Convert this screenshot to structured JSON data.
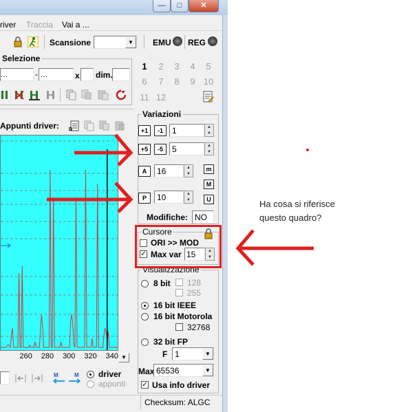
{
  "window": {
    "controls": {
      "minimize": "—",
      "maximize": "□",
      "close": "✕"
    }
  },
  "menu": {
    "items": [
      {
        "label": "river",
        "disabled": false
      },
      {
        "label": "Traccia",
        "disabled": true
      },
      {
        "label": "Vai a ...",
        "disabled": false
      }
    ]
  },
  "toolbar": {
    "scansione_label": "Scansione",
    "scansione_value": "",
    "emu_label": "EMU",
    "reg_label": "REG"
  },
  "selezione": {
    "title": "Selezione",
    "field1": "...",
    "field2": "...",
    "x_label": "x",
    "x_value": "",
    "dim_label": "dim.",
    "dim_value": ""
  },
  "numbers": {
    "row1": [
      "1",
      "2",
      "3",
      "4",
      "5"
    ],
    "row2": [
      "6",
      "7",
      "8",
      "9",
      "10"
    ],
    "row3": [
      "11",
      "12"
    ]
  },
  "appunti": {
    "label": "Appunti driver:"
  },
  "variazioni": {
    "title": "Variazioni",
    "v1": "1",
    "v2": "5",
    "v3": "16",
    "v4": "10",
    "modifiche_label": "Modifiche:",
    "modifiche_value": "NO",
    "icons": {
      "a": "+1",
      "b": "-1",
      "c": "+5",
      "d": "-5",
      "e": "A",
      "f": "P",
      "g": "m",
      "h": "M",
      "i": "U"
    }
  },
  "cursore": {
    "title": "Cursore",
    "ori_mod": "ORI >> MOD",
    "max_var_label": "Max var",
    "max_var_value": "15",
    "ori_checked": false,
    "max_checked": true
  },
  "visualizzazione": {
    "title": "Visualizzazione",
    "bit8": "8 bit",
    "v128": "128",
    "v255": "255",
    "bit16ieee": "16 bit IEEE",
    "bit16moto": "16 bit Motorola",
    "v32768": "32768",
    "bit32fp": "32 bit FP",
    "f_label": "F",
    "f_value": "1",
    "max_label": "Max",
    "max_value": "65536",
    "usa_info": "Usa info driver",
    "selected": "16 bit IEEE"
  },
  "bottom": {
    "driver_label": "driver",
    "appunti_label": "appunti"
  },
  "status": {
    "checksum": "Checksum: ALGC"
  },
  "chart_data": {
    "type": "line",
    "xticks": [
      "260",
      "280",
      "300",
      "320",
      "340"
    ],
    "xlim": [
      236,
      346
    ],
    "series_color": "#c83c3c",
    "cursor_color": "#000000",
    "grid": "dashed horizontal"
  },
  "annotation": {
    "text": "Ha cosa si riferisce questo quadro?",
    "color": "#e02020"
  }
}
